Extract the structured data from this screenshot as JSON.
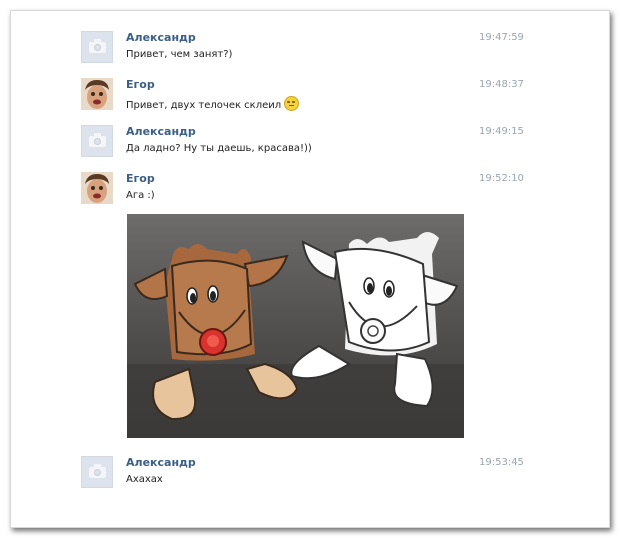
{
  "messages": [
    {
      "author": "Александр",
      "text": "Привет, чем занят?)",
      "time": "19:47:59",
      "avatar": "camera-placeholder"
    },
    {
      "author": "Егор",
      "text": "Привет, двух  телочек склеил",
      "time": "19:48:37",
      "avatar": "user-photo",
      "emoji": "blush-smiley"
    },
    {
      "author": "Александр",
      "text": "Да ладно? Ну ты даешь, красава!))",
      "time": "19:49:15",
      "avatar": "camera-placeholder"
    },
    {
      "author": "Егор",
      "text": "Ага :)",
      "time": "19:52:10",
      "avatar": "user-photo",
      "attachment": "photo-paper-deer-figures"
    },
    {
      "author": "Александр",
      "text": "Ахахах",
      "time": "19:53:45",
      "avatar": "camera-placeholder"
    }
  ],
  "colors": {
    "author": "#3b5f85",
    "text": "#222222",
    "time": "#9aa5b1",
    "avatar_placeholder": "#dde3ec"
  }
}
